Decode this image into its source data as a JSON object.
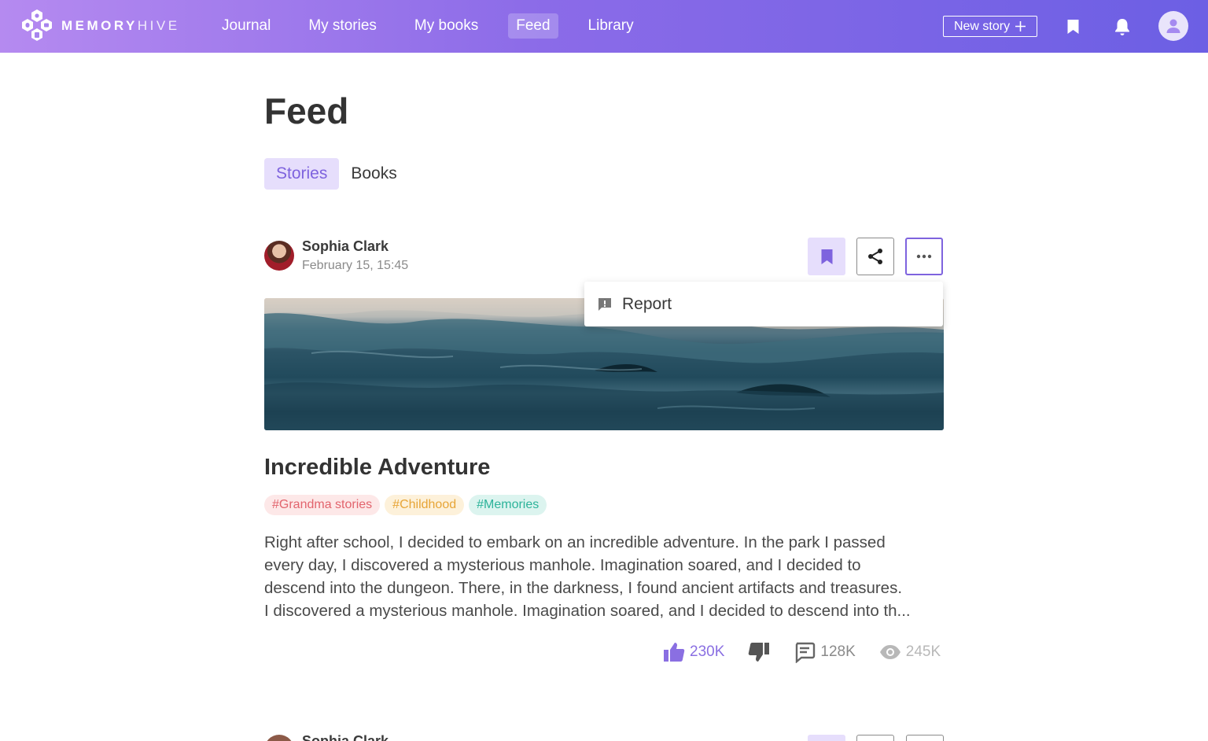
{
  "app": {
    "logo_bold": "MEMORY",
    "logo_light": "HIVE",
    "brand_gradient": [
      "#b58af0",
      "#6c5fe4"
    ]
  },
  "nav": {
    "items": [
      {
        "label": "Journal"
      },
      {
        "label": "My stories"
      },
      {
        "label": "My books"
      },
      {
        "label": "Feed",
        "active": true
      },
      {
        "label": "Library"
      }
    ],
    "new_story_label": "New story"
  },
  "page": {
    "title": "Feed",
    "tabs": [
      {
        "label": "Stories",
        "active": true
      },
      {
        "label": "Books"
      }
    ]
  },
  "story": {
    "author_name": "Sophia Clark",
    "date": "February 15, 15:45",
    "menu": {
      "report_label": "Report"
    },
    "title": "Incredible Adventure",
    "tags": [
      {
        "label": "#Grandma stories",
        "color": "#e2646d"
      },
      {
        "label": "#Childhood",
        "color": "#e7a537"
      },
      {
        "label": "#Memories",
        "color": "#2db39a"
      }
    ],
    "body_lines": [
      "Right after school, I decided to embark on an incredible adventure. In the park I passed",
      "every day, I discovered a mysterious manhole. Imagination soared, and I decided to",
      "descend into the dungeon. There, in the darkness, I found ancient artifacts and treasures.",
      "I discovered a mysterious manhole. Imagination soared, and I decided to descend into th..."
    ],
    "stats": {
      "likes": "230K",
      "comments": "128K",
      "views": "245K"
    }
  },
  "next_story": {
    "author_name": "Sophia Clark"
  },
  "colors": {
    "accent": "#7e63de",
    "accent_light": "#e6defc"
  }
}
